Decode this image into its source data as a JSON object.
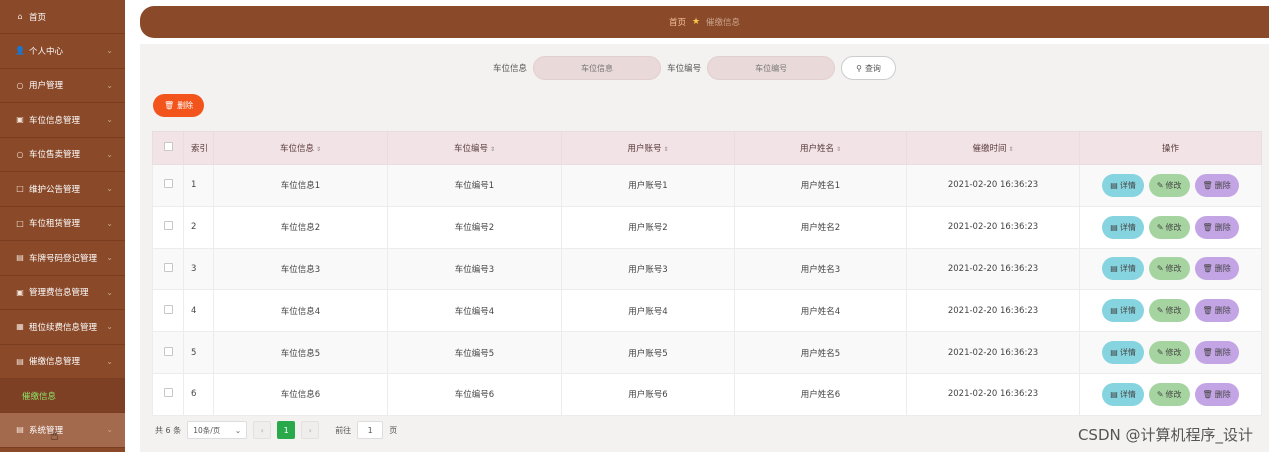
{
  "sidebar": {
    "items": [
      {
        "icon": "home-icon",
        "glyph": "⌂",
        "label": "首页",
        "chevron": ""
      },
      {
        "icon": "user-icon",
        "glyph": "👤",
        "label": "个人中心",
        "chevron": "⌄"
      },
      {
        "icon": "users-icon",
        "glyph": "○",
        "label": "用户管理",
        "chevron": "⌄"
      },
      {
        "icon": "parking-info-icon",
        "glyph": "▣",
        "label": "车位信息管理",
        "chevron": "⌄"
      },
      {
        "icon": "parking-sale-icon",
        "glyph": "○",
        "label": "车位售卖管理",
        "chevron": "⌄"
      },
      {
        "icon": "announcement-icon",
        "glyph": "□",
        "label": "维护公告管理",
        "chevron": "⌄"
      },
      {
        "icon": "rental-icon",
        "glyph": "□",
        "label": "车位租赁管理",
        "chevron": "⌄"
      },
      {
        "icon": "plate-icon",
        "glyph": "▤",
        "label": "车牌号码登记管理",
        "chevron": "⌄"
      },
      {
        "icon": "fee-icon",
        "glyph": "▣",
        "label": "管理费信息管理",
        "chevron": "⌄"
      },
      {
        "icon": "renewal-icon",
        "glyph": "▦",
        "label": "租位续费信息管理",
        "chevron": "⌄"
      },
      {
        "icon": "reminder-icon",
        "glyph": "▤",
        "label": "催缴信息管理",
        "chevron": "⌄"
      }
    ],
    "sub_item": "催缴信息",
    "system": {
      "icon": "system-icon",
      "glyph": "▤",
      "label": "系统管理",
      "chevron": "⌄"
    }
  },
  "breadcrumb": {
    "home": "首页",
    "current": "催缴信息"
  },
  "search": {
    "label1": "车位信息",
    "placeholder1": "车位信息",
    "label2": "车位编号",
    "placeholder2": "车位编号",
    "button": "查询"
  },
  "toolbar": {
    "delete_label": "删除"
  },
  "table": {
    "headers": {
      "index": "索引",
      "spot_info": "车位信息",
      "spot_no": "车位编号",
      "account": "用户账号",
      "name": "用户姓名",
      "time": "催缴时间",
      "ops": "操作"
    },
    "rows": [
      {
        "index": "1",
        "spot_info": "车位信息1",
        "spot_no": "车位编号1",
        "account": "用户账号1",
        "name": "用户姓名1",
        "time": "2021-02-20 16:36:23"
      },
      {
        "index": "2",
        "spot_info": "车位信息2",
        "spot_no": "车位编号2",
        "account": "用户账号2",
        "name": "用户姓名2",
        "time": "2021-02-20 16:36:23"
      },
      {
        "index": "3",
        "spot_info": "车位信息3",
        "spot_no": "车位编号3",
        "account": "用户账号3",
        "name": "用户姓名3",
        "time": "2021-02-20 16:36:23"
      },
      {
        "index": "4",
        "spot_info": "车位信息4",
        "spot_no": "车位编号4",
        "account": "用户账号4",
        "name": "用户姓名4",
        "time": "2021-02-20 16:36:23"
      },
      {
        "index": "5",
        "spot_info": "车位信息5",
        "spot_no": "车位编号5",
        "account": "用户账号5",
        "name": "用户姓名5",
        "time": "2021-02-20 16:36:23"
      },
      {
        "index": "6",
        "spot_info": "车位信息6",
        "spot_no": "车位编号6",
        "account": "用户账号6",
        "name": "用户姓名6",
        "time": "2021-02-20 16:36:23"
      }
    ],
    "actions": {
      "detail": "详情",
      "edit": "修改",
      "remove": "删除"
    }
  },
  "pagination": {
    "total": "共 6 条",
    "page_size": "10条/页",
    "current": "1",
    "goto_label": "前往",
    "goto_value": "1",
    "page_suffix": "页"
  },
  "watermark": "CSDN @计算机程序_设计",
  "colors": {
    "sidebar": "#8a4a2a",
    "accent_green": "#2aa94a",
    "delete_orange": "#f2541c",
    "detail": "#86d4df",
    "edit": "#a6d4a0",
    "remove": "#c3a4e4"
  }
}
